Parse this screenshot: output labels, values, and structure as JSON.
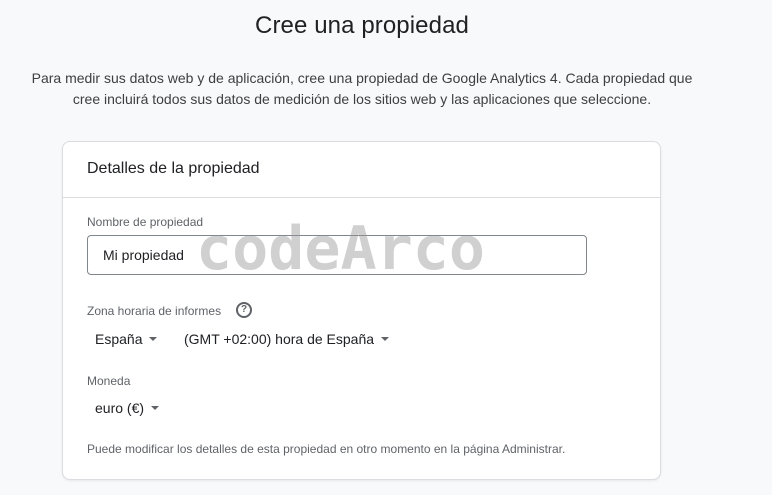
{
  "page": {
    "title": "Cree una propiedad",
    "intro_line1": "Para medir sus datos web y de aplicación, cree una propiedad de Google Analytics 4. Cada propiedad que",
    "intro_line2": "cree incluirá todos sus datos de medición de los sitios web y las aplicaciones que seleccione."
  },
  "card": {
    "header": "Detalles de la propiedad",
    "property_name": {
      "label": "Nombre de propiedad",
      "value": "Mi propiedad"
    },
    "timezone": {
      "label": "Zona horaria de informes",
      "help_icon": "help-circle-icon",
      "country": "España",
      "zone": "(GMT +02:00) hora de España"
    },
    "currency": {
      "label": "Moneda",
      "value": "euro (€)"
    },
    "footnote": "Puede modificar los detalles de esta propiedad en otro momento en la página Administrar."
  },
  "watermark": "codeArco",
  "colors": {
    "background": "#f8f9fa",
    "card_border": "#dadce0",
    "text_primary": "#202124",
    "text_secondary": "#5f6368"
  }
}
